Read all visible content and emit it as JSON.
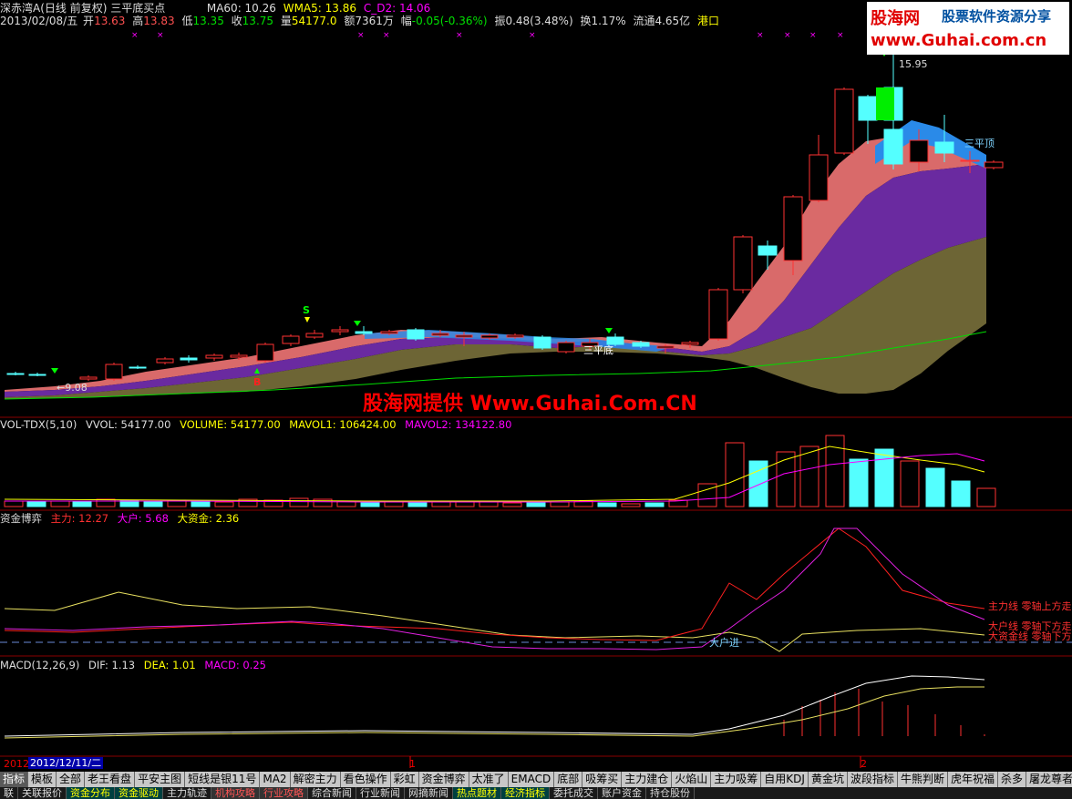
{
  "header": {
    "title": "深赤湾A(日线 前复权) 三平底买点",
    "ma60": "MA60: 10.26",
    "wma5": "WMA5: 13.86",
    "cd2": "C_D2: 14.06",
    "date": "2013/02/08/五",
    "open_label": "开",
    "open": "13.63",
    "high_label": "高",
    "high": "13.83",
    "low_label": "低",
    "low": "13.35",
    "close_label": "收",
    "close": "13.75",
    "vol_label": "量",
    "vol": "54177.0",
    "amount_label": "额",
    "amount": "7361万",
    "change_label": "幅",
    "change": "-0.05(-0.36%)",
    "swing": "振0.48(3.48%)",
    "turnover": "换1.17%",
    "float_cap": "流通4.65亿",
    "market": "港口"
  },
  "logo": {
    "name": "股海网",
    "slogan": "股票软件资源分享",
    "url": "www.Guhai.com.cn"
  },
  "watermark": "股海网提供 Www.Guhai.Com.CN",
  "main_panel": {
    "price_high_marker": "15.95",
    "price_low_marker": "9.08",
    "top_label": "三平顶",
    "bottom_label": "三平底",
    "signal_s": "S",
    "signal_b": "B"
  },
  "vol_panel": {
    "name": "VOL-TDX(5,10)",
    "vvol": "VVOL: 54177.00",
    "volume": "VOLUME: 54177.00",
    "mavol1": "MAVOL1: 106424.00",
    "mavol2": "MAVOL2: 134122.80"
  },
  "fund_panel": {
    "name": "资金博弈",
    "main": "主力: 12.27",
    "big": "大户: 5.68",
    "bigfund": "大资金: 2.36",
    "ann_main": "主力线 零轴上方走",
    "ann_big": "大户线 零轴下方走",
    "ann_bigfund": "大资金线 零轴下方",
    "ann_enter": "大户进"
  },
  "macd_panel": {
    "name": "MACD(12,26,9)",
    "dif": "DIF: 1.13",
    "dea": "DEA: 1.01",
    "macd": "MACD: 0.25"
  },
  "time_axis": {
    "year": "2012",
    "cursor_date": "2012/12/11/二",
    "tick1": "1",
    "tick2": "2"
  },
  "tabs": [
    "指标",
    "模板",
    "全部",
    "老王看盘",
    "平安主图",
    "短线是银11号",
    "MA2",
    "解密主力",
    "看色操作",
    "彩虹",
    "资金博弈",
    "太准了",
    "EMACD",
    "底部",
    "吸筹买",
    "主力建仓",
    "火焰山",
    "主力吸筹",
    "自用KDJ",
    "黄金坑",
    "波段指标",
    "牛熊判断",
    "虎年祝福",
    "杀多",
    "屠龙尊者"
  ],
  "tabs2": [
    "联",
    "关联报价",
    "资金分布",
    "资金驱动",
    "主力轨迹",
    "机构攻略",
    "行业攻略",
    "综合新闻",
    "行业新闻",
    "网摘新闻",
    "热点题材",
    "经济指标",
    "委托成交",
    "账户资金",
    "持仓股份"
  ],
  "colors": {
    "up": "#ff3232",
    "down": "#54ffff",
    "ma_green": "#00cc00",
    "yellow": "#ffff00",
    "magenta": "#ff00ff",
    "pink": "#e06060",
    "purple": "#6a2a9a",
    "olive": "#6b6330",
    "blue": "#2080e0"
  }
}
